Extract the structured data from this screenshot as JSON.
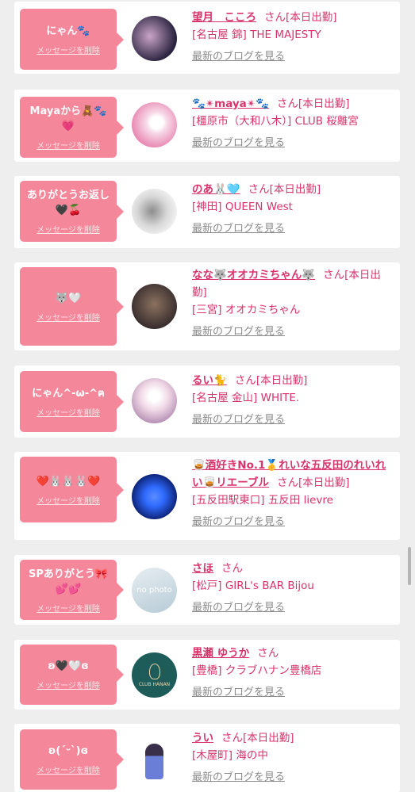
{
  "delete_label": "メッセージを削除",
  "blog_label": "最新のブログを見る",
  "san_suffix": "さん",
  "on_duty_label": "[本日出勤]",
  "colors": {
    "accent": "#d8336b",
    "bubble": "#f4879a"
  },
  "cards": [
    {
      "message": "にゃん🐾",
      "name": "望月　こころ",
      "status": "[本日出勤]",
      "shop": "[名古屋 錦] THE MAJESTY",
      "avatar_colors": [
        "#2b2440",
        "#caa4c8"
      ]
    },
    {
      "message": "Mayaから🧸🐾💗",
      "name": "🐾✴maya✴🐾",
      "status": "[本日出勤]",
      "shop": "[橿原市（大和八木）] CLUB 桜離宮",
      "avatar_colors": [
        "#e98bb4",
        "#f7d9e8"
      ]
    },
    {
      "message": "ありがとうお返し🖤🍒",
      "name": "のあ🐰🩵",
      "status": "[本日出勤]",
      "shop": "[神田] QUEEN West",
      "avatar_colors": [
        "#d8d8d8",
        "#8d8d8d"
      ]
    },
    {
      "message": "🐺🤍",
      "name": "なな🐺オオカミちゃん🐺",
      "status": "[本日出勤]",
      "shop": "[三宮] オオカミちゃん",
      "avatar_colors": [
        "#3b2f2f",
        "#8b7260"
      ]
    },
    {
      "message": "にゃん^-ω-^ฅ",
      "name": "るい🐈",
      "status": "[本日出勤]",
      "shop": "[名古屋 金山] WHITE.",
      "avatar_colors": [
        "#f0d8e6",
        "#b08ab0"
      ]
    },
    {
      "message": "❤️🐰🐰🐰❤️",
      "name": "🥃酒好きNo.1🥇れいな五反田のれいれい🥃リエーブル",
      "status": "[本日出勤]",
      "shop": "[五反田駅東口] 五反田 lievre",
      "avatar_colors": [
        "#0b1d6b",
        "#2f6bff"
      ]
    },
    {
      "message": "SPありがとう🎀💕💕",
      "name": "さほ",
      "status": "",
      "shop": "[松戸] GIRL's BAR Bijou",
      "avatar_colors": [
        "#b7cbd6",
        "#e7eef2"
      ],
      "avatar_text": "no photo"
    },
    {
      "message": "ʚ🖤🤍ɞ",
      "name": "黒瀬 ゆうか",
      "status": "",
      "shop": "[豊橋] クラブハナン豊橋店",
      "avatar_colors": [
        "#1d5c58",
        "#2c7c76"
      ],
      "avatar_text": "CLUB HANAN"
    },
    {
      "message": "ʚ(ˊᵕˋ)ɞ",
      "name": "うい",
      "status": "[本日出勤]",
      "shop": "[木屋町] 海の中",
      "avatar_colors": [
        "#ffffff",
        "#6a7ed8"
      ]
    }
  ]
}
